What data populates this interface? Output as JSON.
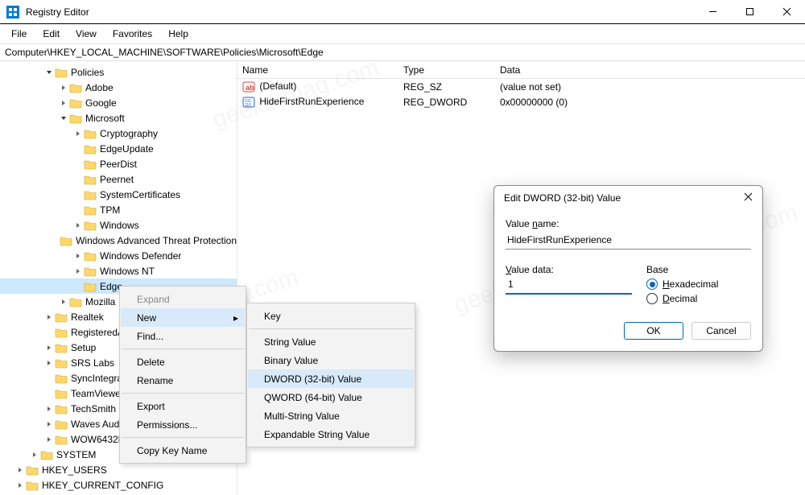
{
  "window": {
    "title": "Registry Editor"
  },
  "menu": {
    "file": "File",
    "edit": "Edit",
    "view": "View",
    "favorites": "Favorites",
    "help": "Help"
  },
  "address": "Computer\\HKEY_LOCAL_MACHINE\\SOFTWARE\\Policies\\Microsoft\\Edge",
  "tree": {
    "policies": "Policies",
    "adobe": "Adobe",
    "google": "Google",
    "microsoft": "Microsoft",
    "cryptography": "Cryptography",
    "edgeupdate": "EdgeUpdate",
    "peerdist": "PeerDist",
    "peernet": "Peernet",
    "systemcertificates": "SystemCertificates",
    "tpm": "TPM",
    "windows": "Windows",
    "watp": "Windows Advanced Threat Protection",
    "defender": "Windows Defender",
    "winnt": "Windows NT",
    "edge": "Edge",
    "mozilla": "Mozilla",
    "realtek": "Realtek",
    "registered": "RegisteredApplications",
    "setup": "Setup",
    "srs": "SRS Labs",
    "syncinteg": "SyncIntegration",
    "teamview": "TeamViewer",
    "techsmith": "TechSmith",
    "wavesau": "Waves Audio",
    "wow643": "WOW6432Node",
    "system": "SYSTEM",
    "hkeyusers": "HKEY_USERS",
    "hkeycc": "HKEY_CURRENT_CONFIG"
  },
  "list": {
    "hdr_name": "Name",
    "hdr_type": "Type",
    "hdr_data": "Data",
    "row0": {
      "name": "(Default)",
      "type": "REG_SZ",
      "data": "(value not set)"
    },
    "row1": {
      "name": "HideFirstRunExperience",
      "type": "REG_DWORD",
      "data": "0x00000000 (0)"
    }
  },
  "ctx1": {
    "expand": "Expand",
    "new": "New",
    "find": "Find...",
    "delete": "Delete",
    "rename": "Rename",
    "export": "Export",
    "permissions": "Permissions...",
    "copykey": "Copy Key Name"
  },
  "ctx2": {
    "key": "Key",
    "string": "String Value",
    "binary": "Binary Value",
    "dword": "DWORD (32-bit) Value",
    "qword": "QWORD (64-bit) Value",
    "multi": "Multi-String Value",
    "expand": "Expandable String Value"
  },
  "dialog": {
    "title": "Edit DWORD (32-bit) Value",
    "valname_lbl": "Value name:",
    "valname": "HideFirstRunExperience",
    "valdata_lbl": "Value data:",
    "valdata": "1",
    "base_lbl": "Base",
    "hex": "Hexadecimal",
    "dec": "Decimal",
    "ok": "OK",
    "cancel": "Cancel"
  },
  "watermark": "geekermag.com"
}
